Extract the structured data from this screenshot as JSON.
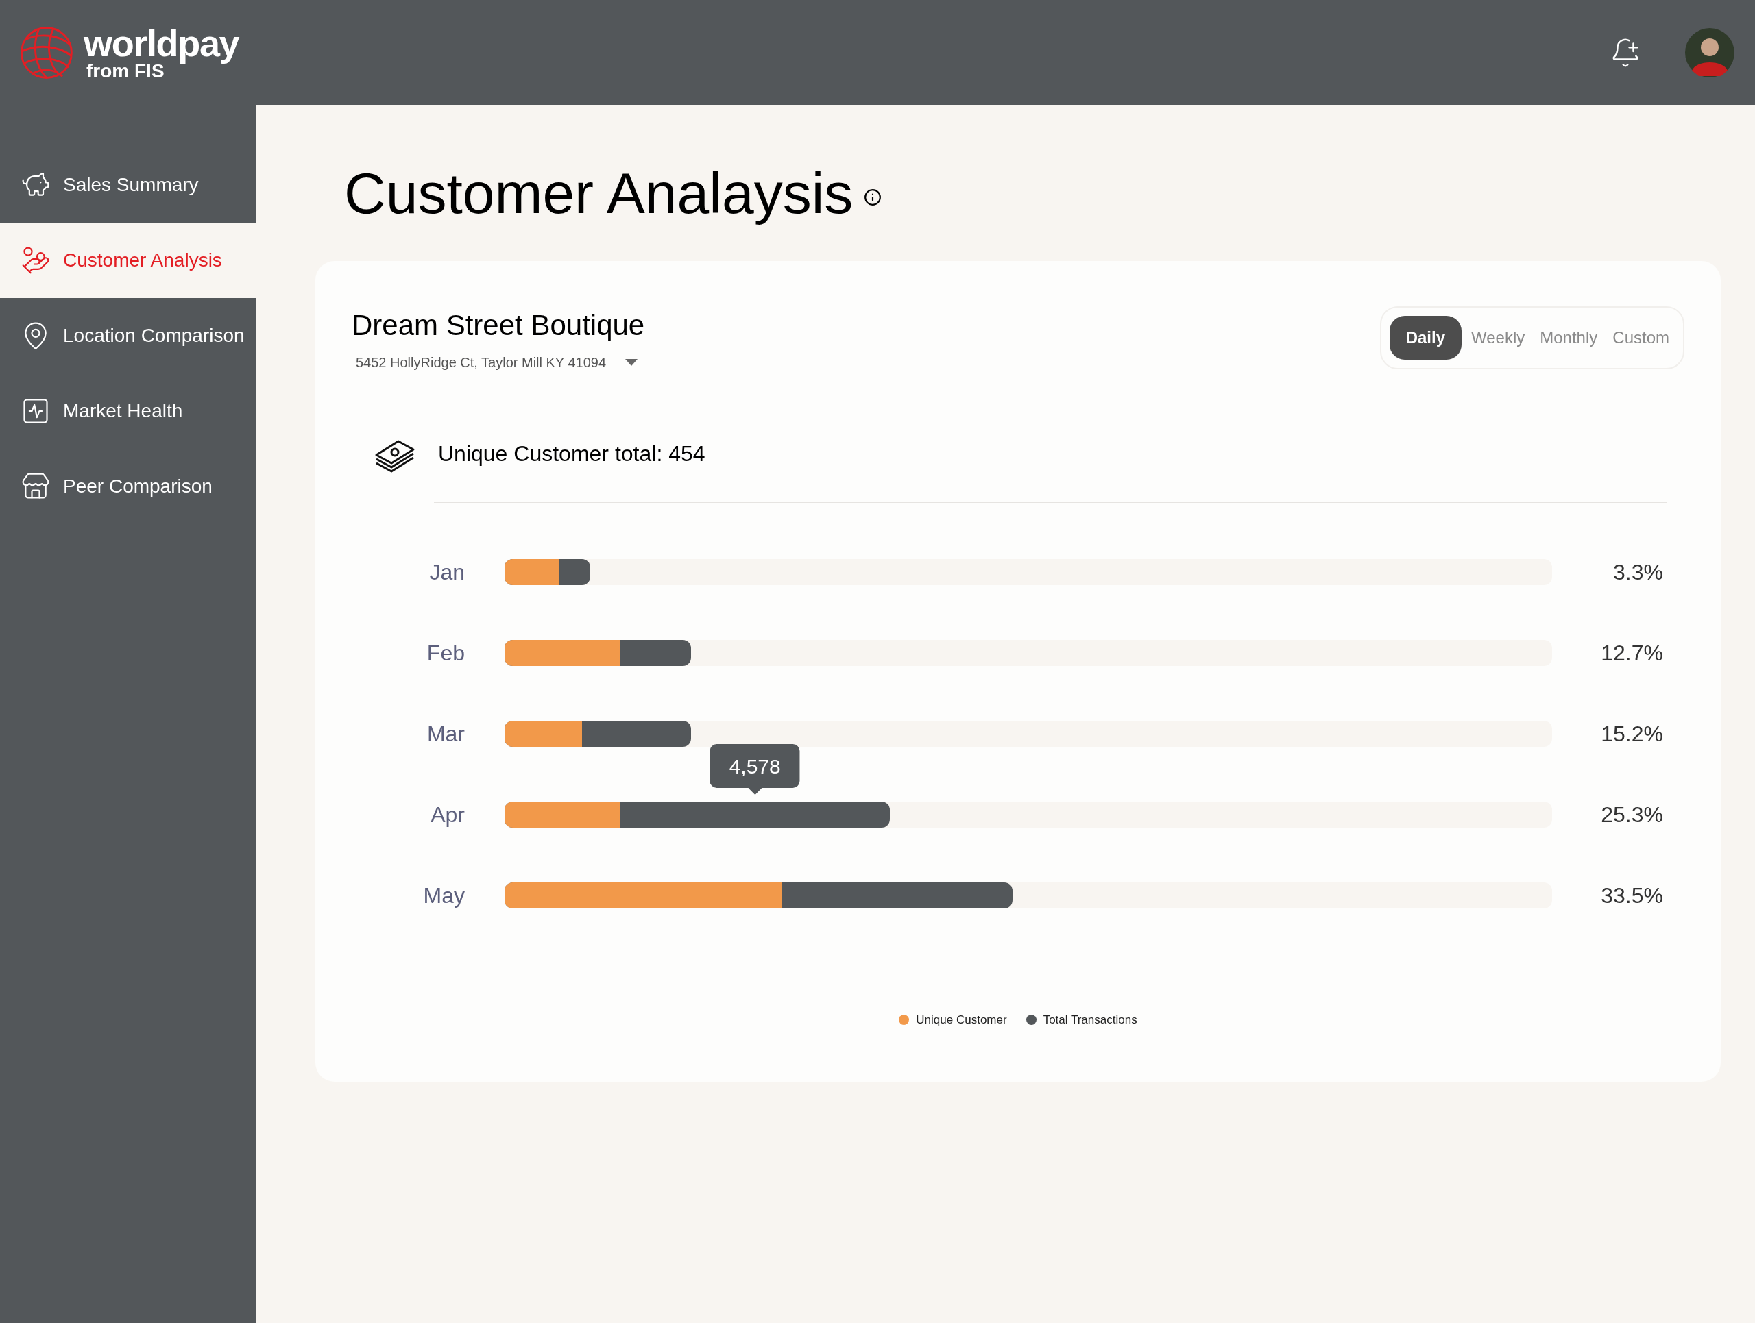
{
  "header": {
    "logo": {
      "name": "worldpay",
      "tagline": "from FIS"
    }
  },
  "sidebar": {
    "items": [
      {
        "label": "Sales Summary",
        "selected": false
      },
      {
        "label": "Customer Analysis",
        "selected": true
      },
      {
        "label": "Location Comparison",
        "selected": false
      },
      {
        "label": "Market Health",
        "selected": false
      },
      {
        "label": "Peer Comparison",
        "selected": false
      }
    ]
  },
  "page": {
    "title": "Customer Analaysis"
  },
  "card": {
    "store_name": "Dream Street Boutique",
    "address": "5452 HollyRidge Ct, Taylor Mill KY 41094",
    "periods": [
      {
        "label": "Daily",
        "selected": true
      },
      {
        "label": "Weekly",
        "selected": false
      },
      {
        "label": "Monthly",
        "selected": false
      },
      {
        "label": "Custom",
        "selected": false
      }
    ],
    "total_label": "Unique Customer total: 454",
    "rows": [
      {
        "month": "Jan",
        "unique": {
          "level": 0.052
        },
        "total": {
          "level": 0.082
        },
        "percent": "3.3%"
      },
      {
        "month": "Feb",
        "unique": {
          "level": 0.11
        },
        "total": {
          "level": 0.178
        },
        "percent": "12.7%"
      },
      {
        "month": "Mar",
        "unique": {
          "level": 0.074
        },
        "total": {
          "level": 0.178
        },
        "percent": "15.2%"
      },
      {
        "month": "Apr",
        "unique": {
          "level": 0.11
        },
        "total": {
          "level": 0.368
        },
        "percent": "25.3%",
        "tooltip": "4,578"
      },
      {
        "month": "May",
        "unique": {
          "level": 0.265
        },
        "total": {
          "level": 0.485
        },
        "percent": "33.5%"
      }
    ],
    "legend": [
      {
        "label": "Unique Customer",
        "color": "#f2994a"
      },
      {
        "label": "Total Transactions",
        "color": "#53575a"
      }
    ]
  }
}
